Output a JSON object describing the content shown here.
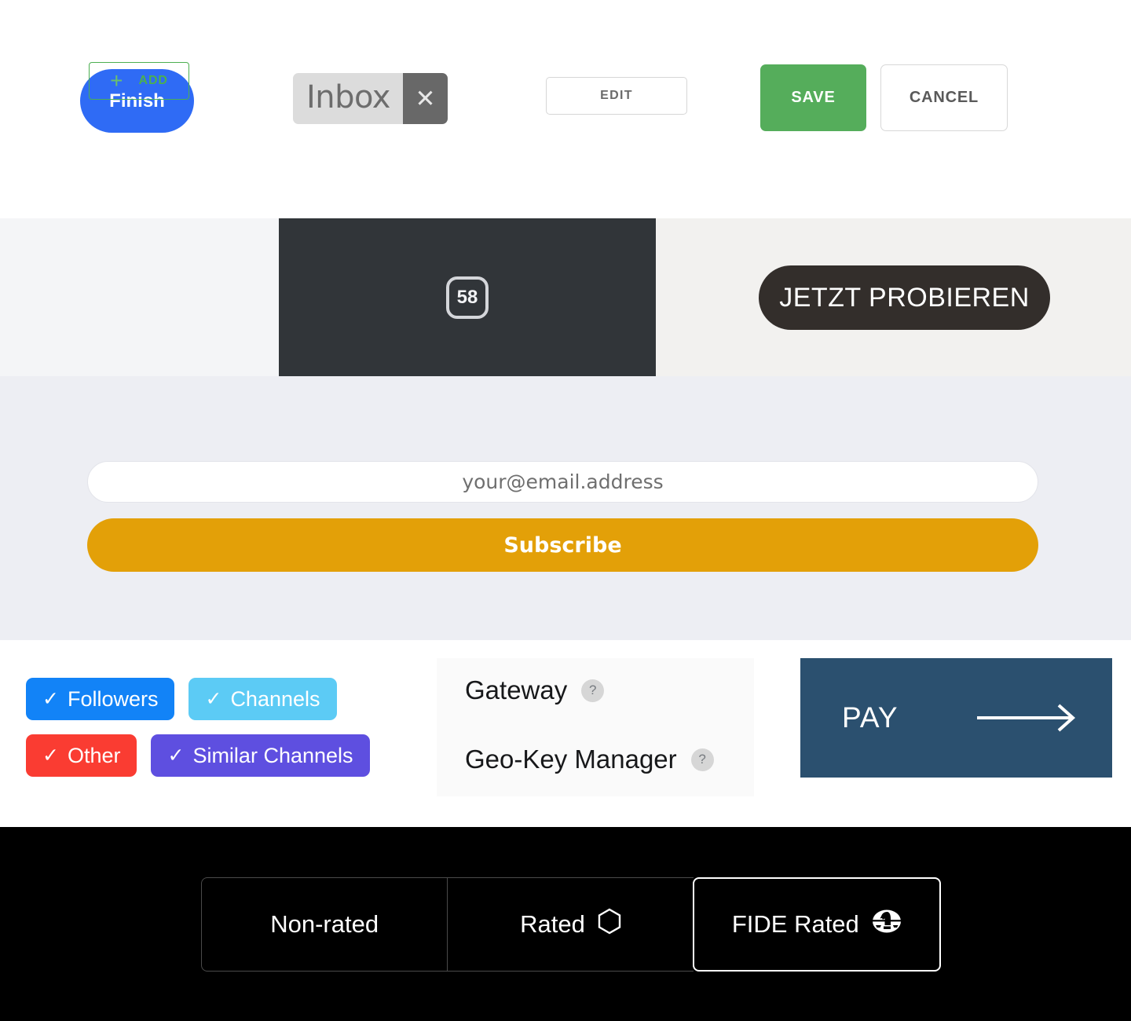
{
  "toolbar": {
    "finish_label": "Finish",
    "inbox_tag_label": "Inbox",
    "inbox_tag_close_icon": "close-x-icon",
    "edit_label": "EDIT",
    "save_label": "SAVE",
    "cancel_label": "CANCEL"
  },
  "tri_panel": {
    "add_icon": "plus-icon",
    "add_label": "ADD",
    "badge_value": "58",
    "cta_label": "JETZT PROBIEREN"
  },
  "subscribe": {
    "email_placeholder": "your@email.address",
    "email_value": "",
    "button_label": "Subscribe"
  },
  "chips": [
    {
      "label": "Followers",
      "tick": "✓",
      "color": "#1283f7"
    },
    {
      "label": "Channels",
      "tick": "✓",
      "color": "#5ccbf5"
    },
    {
      "label": "Other",
      "tick": "✓",
      "color": "#fa3c32"
    },
    {
      "label": "Similar Channels",
      "tick": "✓",
      "color": "#5e4fe0"
    }
  ],
  "gateway": {
    "rows": [
      {
        "label": "Gateway",
        "help": "?"
      },
      {
        "label": "Geo-Key Manager",
        "help": "?"
      }
    ]
  },
  "pay": {
    "label": "PAY",
    "arrow_icon": "arrow-right-icon",
    "color": "#2b506f"
  },
  "rated_selector": {
    "options": [
      {
        "label": "Non-rated",
        "icon": "",
        "active": false
      },
      {
        "label": "Rated",
        "icon": "hexagon-icon",
        "active": false
      },
      {
        "label": "FIDE Rated",
        "icon": "fide-knight-icon",
        "active": true
      }
    ]
  },
  "colors": {
    "finish_blue": "#2f6bf5",
    "save_green": "#55ad5b",
    "add_green": "#4caf50",
    "subscribe_orange": "#e3a008",
    "dark_panel": "#313539",
    "cta_dark": "#332e2b",
    "pay_navy": "#2b506f"
  }
}
